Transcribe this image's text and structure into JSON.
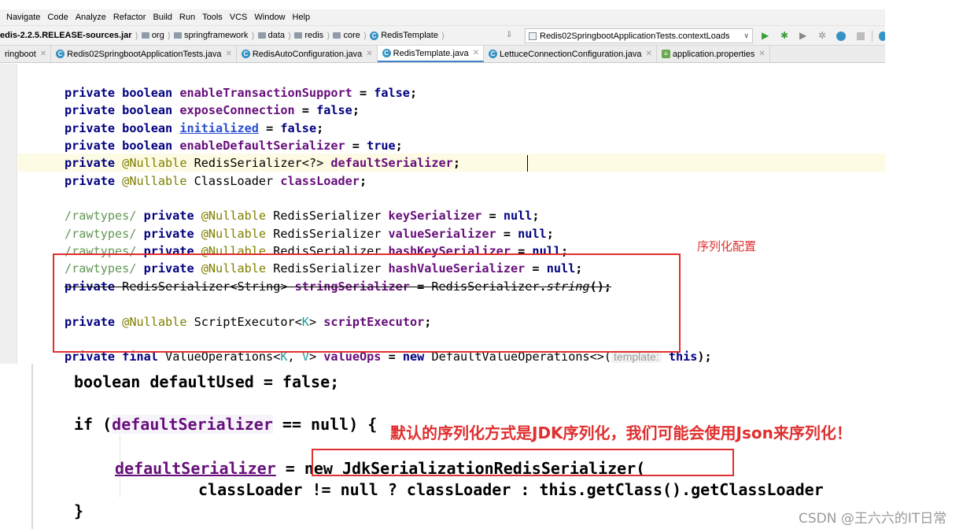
{
  "menu": {
    "items": [
      "Navigate",
      "Code",
      "Analyze",
      "Refactor",
      "Build",
      "Run",
      "Tools",
      "VCS",
      "Window",
      "Help"
    ]
  },
  "navbar": {
    "crumbs": [
      "edis-2.2.5.RELEASE-sources.jar",
      "org",
      "springframework",
      "data",
      "redis",
      "core",
      "RedisTemplate"
    ],
    "run_config": "Redis02SpringbootApplicationTests.contextLoads"
  },
  "tabs": [
    {
      "label": "ringboot",
      "active": false,
      "icon": "none"
    },
    {
      "label": "Redis02SpringbootApplicationTests.java",
      "active": false,
      "icon": "java"
    },
    {
      "label": "RedisAutoConfiguration.java",
      "active": false,
      "icon": "java"
    },
    {
      "label": "RedisTemplate.java",
      "active": true,
      "icon": "java"
    },
    {
      "label": "LettuceConnectionConfiguration.java",
      "active": false,
      "icon": "java"
    },
    {
      "label": "application.properties",
      "active": false,
      "icon": "props"
    }
  ],
  "code": {
    "kw_private": "private",
    "kw_boolean": "boolean",
    "kw_false": "false",
    "kw_true": "true",
    "kw_null": "null",
    "kw_new": "new",
    "kw_final": "final",
    "kw_this": "this",
    "ann_nullable": "@Nullable",
    "cmt_rawtypes": "/rawtypes/",
    "f_enableTransactionSupport": "enableTransactionSupport",
    "f_exposeConnection": "exposeConnection",
    "f_initialized": "initialized",
    "f_enableDefaultSerializer": "enableDefaultSerializer",
    "f_defaultSerializer": "defaultSerializer",
    "f_classLoader": "classLoader",
    "f_keySerializer": "keySerializer",
    "f_valueSerializer": "valueSerializer",
    "f_hashKeySerializer": "hashKeySerializer",
    "f_hashValueSerializer": "hashValueSerializer",
    "f_stringSerializer": "stringSerializer",
    "f_scriptExecutor": "scriptExecutor",
    "f_valueOps": "valueOps",
    "t_redisSerializer": "RedisSerializer",
    "t_redisSerializerWild": "RedisSerializer<?>",
    "t_classLoader": "ClassLoader",
    "t_redisSerializerString": "RedisSerializer<String>",
    "m_string": "string",
    "t_scriptExecutor": "ScriptExecutor<",
    "g_k": "K",
    "t_valueOperations": "ValueOperations<",
    "g_v": "V",
    "t_defaultValueOperations": "DefaultValueOperations<>(",
    "hint_template": "template:"
  },
  "snippet": {
    "line1": "boolean defaultUsed = false;",
    "if_kw": "if (",
    "field": "defaultSerializer",
    "if_rest": " == null) {",
    "assign_rest": " = new JdkSerializationRedisSerializer(",
    "line4": "classLoader != null ? classLoader : this.getClass().getClassLoader",
    "line5": "}"
  },
  "annotations": {
    "serial_config": "序列化配置",
    "default_jdk": "默认的序列化方式是JDK序列化，我们可能会使用Json来序列化！",
    "highlight_color": "#e02f2f"
  },
  "watermark": "CSDN @王六六的IT日常"
}
